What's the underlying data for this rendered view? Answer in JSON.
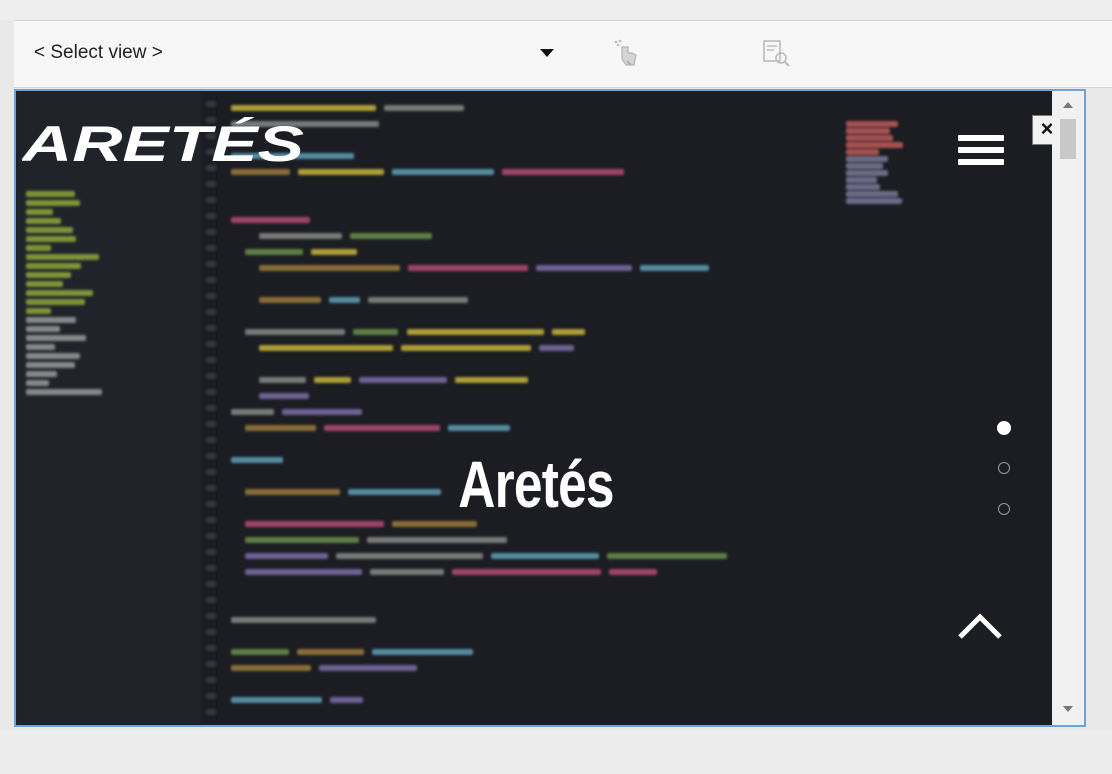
{
  "toolbar": {
    "select_view": {
      "value": "< Select view >"
    },
    "icons": [
      "touch-gesture-icon",
      "inspect-frame-icon"
    ]
  },
  "preview": {
    "logo_text": "ARETÉS",
    "hero_title": "Aretés",
    "close_label": "×",
    "carousel": {
      "slides": 3,
      "active_index": 0
    },
    "colors": {
      "background": "#1b1d22",
      "accent_border": "#6aa3d8",
      "foreground": "#ffffff"
    }
  }
}
